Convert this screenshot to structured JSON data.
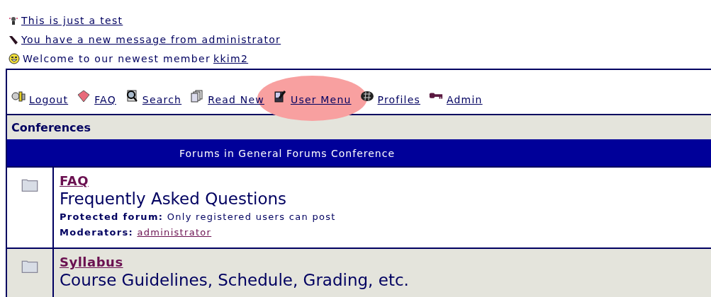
{
  "notices": [
    {
      "kind": "announcement",
      "text": "This is just a test"
    },
    {
      "kind": "message",
      "text": "You have a new message from administrator"
    },
    {
      "kind": "welcome",
      "text": "Welcome to our newest member ",
      "member": "kkim2"
    }
  ],
  "nav": [
    {
      "label": "Logout",
      "highlighted": false
    },
    {
      "label": "FAQ",
      "highlighted": false
    },
    {
      "label": "Search",
      "highlighted": false
    },
    {
      "label": "Read New",
      "highlighted": false
    },
    {
      "label": "User Menu",
      "highlighted": true
    },
    {
      "label": "Profiles",
      "highlighted": false
    },
    {
      "label": "Admin",
      "highlighted": false
    }
  ],
  "section_title": "Conferences",
  "table_header": "Forums in General Forums Conference",
  "forums": [
    {
      "name": "FAQ",
      "description": "Frequently Asked Questions",
      "protected_label": "Protected forum:",
      "protected_text": " Only registered users can post",
      "moderators_label": "Moderators:",
      "moderator": "administrator"
    },
    {
      "name": "Syllabus",
      "description": "Course Guidelines, Schedule, Grading, etc."
    }
  ]
}
